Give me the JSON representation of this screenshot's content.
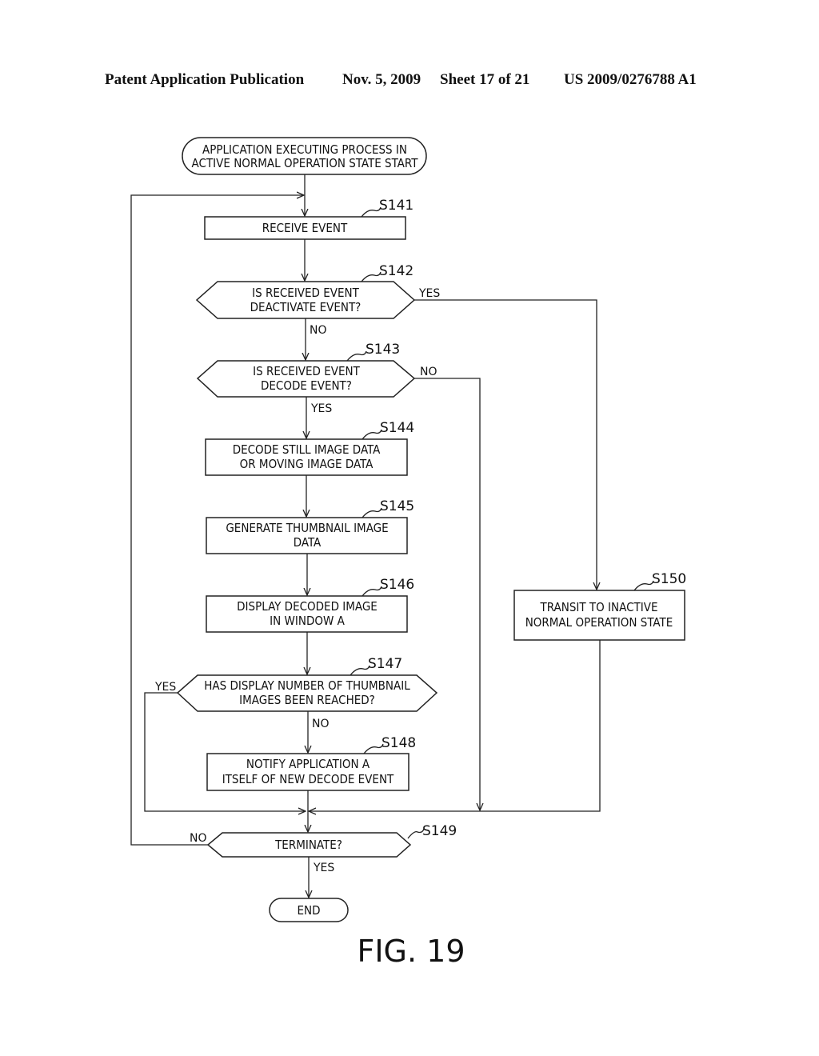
{
  "header": {
    "publication": "Patent Application Publication",
    "date": "Nov. 5, 2009",
    "sheet": "Sheet 17 of 21",
    "number": "US 2009/0276788 A1"
  },
  "flowchart": {
    "start": {
      "line1": "APPLICATION EXECUTING PROCESS IN",
      "line2": "ACTIVE NORMAL OPERATION STATE START"
    },
    "s141": {
      "id": "S141",
      "line1": "RECEIVE EVENT"
    },
    "s142": {
      "id": "S142",
      "line1": "IS RECEIVED EVENT",
      "line2": "DEACTIVATE EVENT?",
      "yes": "YES",
      "no": "NO"
    },
    "s143": {
      "id": "S143",
      "line1": "IS RECEIVED EVENT",
      "line2": "DECODE EVENT?",
      "yes": "YES",
      "no": "NO"
    },
    "s144": {
      "id": "S144",
      "line1": "DECODE STILL IMAGE DATA",
      "line2": "OR MOVING IMAGE DATA"
    },
    "s145": {
      "id": "S145",
      "line1": "GENERATE THUMBNAIL IMAGE",
      "line2": "DATA"
    },
    "s146": {
      "id": "S146",
      "line1": "DISPLAY DECODED IMAGE",
      "line2": "IN WINDOW A"
    },
    "s147": {
      "id": "S147",
      "line1": "HAS DISPLAY NUMBER OF THUMBNAIL",
      "line2": "IMAGES BEEN REACHED?",
      "yes": "YES",
      "no": "NO"
    },
    "s148": {
      "id": "S148",
      "line1": "NOTIFY APPLICATION A",
      "line2": "ITSELF OF NEW DECODE EVENT"
    },
    "s149": {
      "id": "S149",
      "line1": "TERMINATE?",
      "yes": "YES",
      "no": "NO"
    },
    "s150": {
      "id": "S150",
      "line1": "TRANSIT TO INACTIVE",
      "line2": "NORMAL OPERATION STATE"
    },
    "end": {
      "line1": "END"
    }
  },
  "figure_label": "FIG. 19"
}
